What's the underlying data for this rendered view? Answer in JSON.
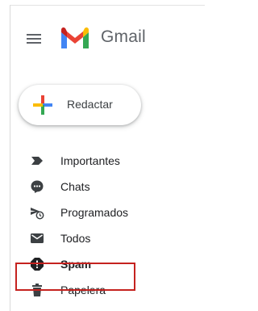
{
  "app": {
    "name": "Gmail",
    "brand_colors": {
      "red": "#ea4335",
      "blue": "#4285f4",
      "green": "#34a853",
      "yellow": "#fbbc04",
      "dark_red": "#c5221f"
    }
  },
  "header": {
    "menu_icon": "hamburger-menu-icon",
    "logo_icon": "gmail-m-logo-icon",
    "logo_text": "Gmail"
  },
  "compose": {
    "label": "Redactar",
    "icon": "plus-colored-icon"
  },
  "sidebar": {
    "items": [
      {
        "label": "Importantes",
        "icon": "label-important-icon",
        "active": false
      },
      {
        "label": "Chats",
        "icon": "chat-bubble-icon",
        "active": false
      },
      {
        "label": "Programados",
        "icon": "scheduled-send-icon",
        "active": false
      },
      {
        "label": "Todos",
        "icon": "envelope-icon",
        "active": false
      },
      {
        "label": "Spam",
        "icon": "report-spam-icon",
        "active": true
      },
      {
        "label": "Papelera",
        "icon": "trash-icon",
        "active": false
      }
    ]
  },
  "annotation": {
    "highlight_color": "#c5221f",
    "highlighted_item": "Spam"
  }
}
